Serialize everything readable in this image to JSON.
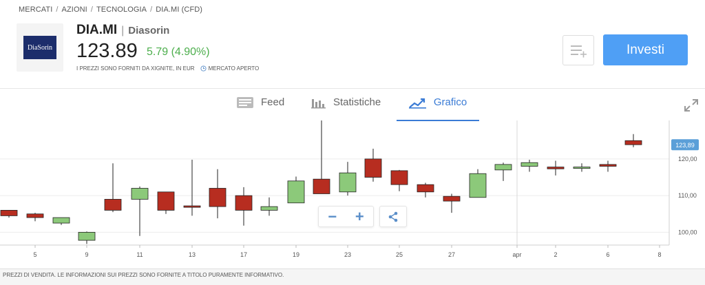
{
  "breadcrumb": [
    "MERCATI",
    "AZIONI",
    "TECNOLOGIA",
    "DIA.MI (CFD)"
  ],
  "breadcrumb_separator": "/",
  "instrument": {
    "logo_text": "DiaSorin",
    "ticker": "DIA.MI",
    "separator": "|",
    "name": "Diasorin",
    "price": "123.89",
    "change": "5.79 (4.90%)",
    "price_note": "I PREZZI SONO FORNITI DA XIGNITE, IN EUR",
    "market_status": "MERCATO APERTO"
  },
  "actions": {
    "watchlist_icon": "list-add-icon",
    "invest_label": "Investi"
  },
  "tabs": [
    {
      "label": "Feed",
      "icon": "feed-icon",
      "active": false
    },
    {
      "label": "Statistiche",
      "icon": "bar-chart-icon",
      "active": false
    },
    {
      "label": "Grafico",
      "icon": "line-chart-icon",
      "active": true
    }
  ],
  "chart_controls": {
    "zoom_out": "−",
    "zoom_in": "+",
    "share_icon": "share-icon",
    "expand_icon": "expand-icon"
  },
  "footer_note": "PREZZI DI VENDITA. LE INFORMAZIONI SUI PREZZI SONO FORNITE A TITOLO PURAMENTE INFORMATIVO.",
  "colors": {
    "up": "#8cc97a",
    "down": "#b72d20",
    "accent": "#4f9ff5",
    "change_positive": "#4cae4c"
  },
  "chart_data": {
    "type": "candlestick",
    "x_tick_labels": [
      "5",
      "9",
      "11",
      "13",
      "17",
      "19",
      "23",
      "25",
      "27",
      "apr",
      "2",
      "6",
      "8"
    ],
    "y_tick_labels": [
      "100,00",
      "110,00",
      "120,00"
    ],
    "ylim": [
      96.5,
      130.5
    ],
    "last_price_label": "123,89",
    "last_price": 123.89,
    "candles": [
      {
        "date": "1",
        "open": 106.0,
        "high": 106.0,
        "low": 104.0,
        "close": 104.5
      },
      {
        "date": "2",
        "open": 105.0,
        "high": 105.3,
        "low": 103.0,
        "close": 104.0
      },
      {
        "date": "4",
        "open": 102.5,
        "high": 104.0,
        "low": 102.0,
        "close": 104.0
      },
      {
        "date": "5",
        "open": 97.8,
        "high": 100.2,
        "low": 96.8,
        "close": 100.0
      },
      {
        "date": "6",
        "open": 109.0,
        "high": 118.8,
        "low": 105.5,
        "close": 106.0
      },
      {
        "date": "9",
        "open": 109.0,
        "high": 112.5,
        "low": 99.0,
        "close": 112.0
      },
      {
        "date": "10",
        "open": 111.0,
        "high": 111.0,
        "low": 105.0,
        "close": 106.0
      },
      {
        "date": "11",
        "open": 107.2,
        "high": 119.8,
        "low": 104.5,
        "close": 106.8
      },
      {
        "date": "12",
        "open": 112.0,
        "high": 117.2,
        "low": 103.8,
        "close": 107.0
      },
      {
        "date": "13",
        "open": 110.0,
        "high": 112.3,
        "low": 101.8,
        "close": 106.0
      },
      {
        "date": "16",
        "open": 106.0,
        "high": 109.5,
        "low": 104.5,
        "close": 107.0
      },
      {
        "date": "17",
        "open": 108.0,
        "high": 115.2,
        "low": 108.0,
        "close": 114.0
      },
      {
        "date": "18",
        "open": 114.5,
        "high": 130.5,
        "low": 110.5,
        "close": 110.5
      },
      {
        "date": "19",
        "open": 111.0,
        "high": 119.2,
        "low": 110.0,
        "close": 116.2
      },
      {
        "date": "20",
        "open": 120.0,
        "high": 122.8,
        "low": 113.8,
        "close": 115.0
      },
      {
        "date": "23",
        "open": 116.8,
        "high": 117.0,
        "low": 111.2,
        "close": 113.0
      },
      {
        "date": "24",
        "open": 113.0,
        "high": 113.5,
        "low": 109.5,
        "close": 111.0
      },
      {
        "date": "25",
        "open": 109.8,
        "high": 110.5,
        "low": 105.3,
        "close": 108.5
      },
      {
        "date": "26",
        "open": 109.5,
        "high": 117.2,
        "low": 109.5,
        "close": 116.0
      },
      {
        "date": "27",
        "open": 117.0,
        "high": 119.0,
        "low": 114.0,
        "close": 118.5
      },
      {
        "date": "30",
        "open": 118.0,
        "high": 119.8,
        "low": 116.5,
        "close": 119.0
      },
      {
        "date": "31",
        "open": 117.8,
        "high": 119.5,
        "low": 115.5,
        "close": 117.3
      },
      {
        "date": "apr",
        "open": 117.5,
        "high": 118.8,
        "low": 116.5,
        "close": 117.8
      },
      {
        "date": "2",
        "open": 118.5,
        "high": 119.5,
        "low": 116.5,
        "close": 118.0
      },
      {
        "date": "3",
        "open": 125.0,
        "high": 126.8,
        "low": 123.2,
        "close": 123.89
      }
    ]
  }
}
